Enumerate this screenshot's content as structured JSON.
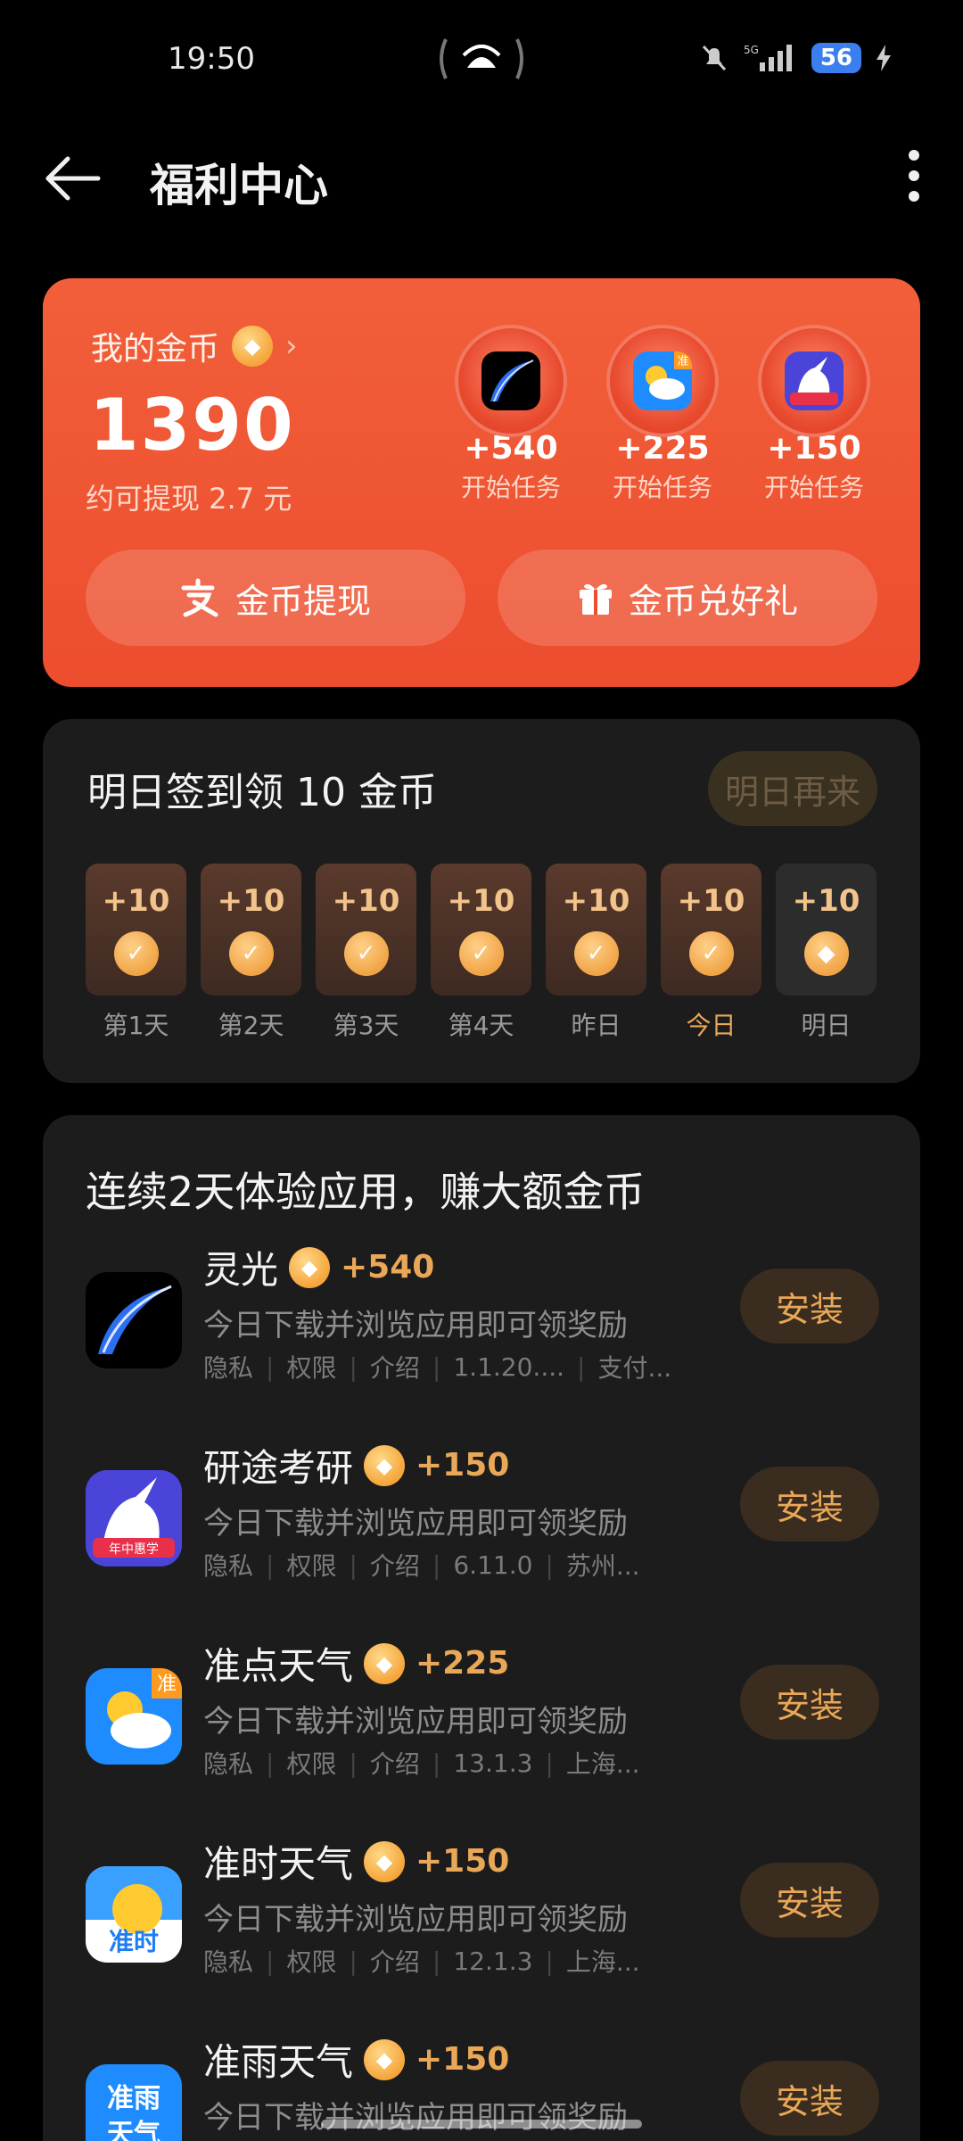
{
  "status_bar": {
    "time": "19:50",
    "battery": "56",
    "network": "5G"
  },
  "header": {
    "title": "福利中心"
  },
  "coin_card": {
    "label": "我的金币",
    "balance": "1390",
    "withdraw_text": "约可提现 2.7 元",
    "tasks": [
      {
        "amount": "+540",
        "label": "开始任务"
      },
      {
        "amount": "+225",
        "label": "开始任务"
      },
      {
        "amount": "+150",
        "label": "开始任务"
      }
    ],
    "withdraw_button": "金币提现",
    "gift_button": "金币兑好礼"
  },
  "sign_in": {
    "title": "明日签到领 10 金币",
    "button": "明日再来",
    "days": [
      {
        "reward": "+10",
        "label": "第1天",
        "state": "done"
      },
      {
        "reward": "+10",
        "label": "第2天",
        "state": "done"
      },
      {
        "reward": "+10",
        "label": "第3天",
        "state": "done"
      },
      {
        "reward": "+10",
        "label": "第4天",
        "state": "done"
      },
      {
        "reward": "+10",
        "label": "昨日",
        "state": "done"
      },
      {
        "reward": "+10",
        "label": "今日",
        "state": "today"
      },
      {
        "reward": "+10",
        "label": "明日",
        "state": "future"
      }
    ]
  },
  "apps_section": {
    "title": "连续2天体验应用，赚大额金币",
    "apps": [
      {
        "name": "灵光",
        "reward": "+540",
        "desc": "今日下载并浏览应用即可领奖励",
        "meta": [
          "隐私",
          "权限",
          "介绍",
          "1.1.20....",
          "支付..."
        ],
        "button": "安装"
      },
      {
        "name": "研途考研",
        "reward": "+150",
        "desc": "今日下载并浏览应用即可领奖励",
        "meta": [
          "隐私",
          "权限",
          "介绍",
          "6.11.0",
          "苏州..."
        ],
        "button": "安装"
      },
      {
        "name": "准点天气",
        "reward": "+225",
        "desc": "今日下载并浏览应用即可领奖励",
        "meta": [
          "隐私",
          "权限",
          "介绍",
          "13.1.3",
          "上海..."
        ],
        "button": "安装"
      },
      {
        "name": "准时天气",
        "reward": "+150",
        "desc": "今日下载并浏览应用即可领奖励",
        "meta": [
          "隐私",
          "权限",
          "介绍",
          "12.1.3",
          "上海..."
        ],
        "button": "安装"
      },
      {
        "name": "准雨天气",
        "reward": "+150",
        "desc": "今日下载并浏览应用即可领奖励",
        "meta": [],
        "button": "安装"
      }
    ]
  },
  "icon_text": {
    "zhun": "准",
    "zhunshi": "准时",
    "zhunyu_1": "准雨",
    "zhunyu_2": "天气",
    "nianzhong": "年中惠学"
  },
  "colors": {
    "accent": "#e9a758",
    "card_red": "#ec4d2e",
    "background": "#000000"
  }
}
